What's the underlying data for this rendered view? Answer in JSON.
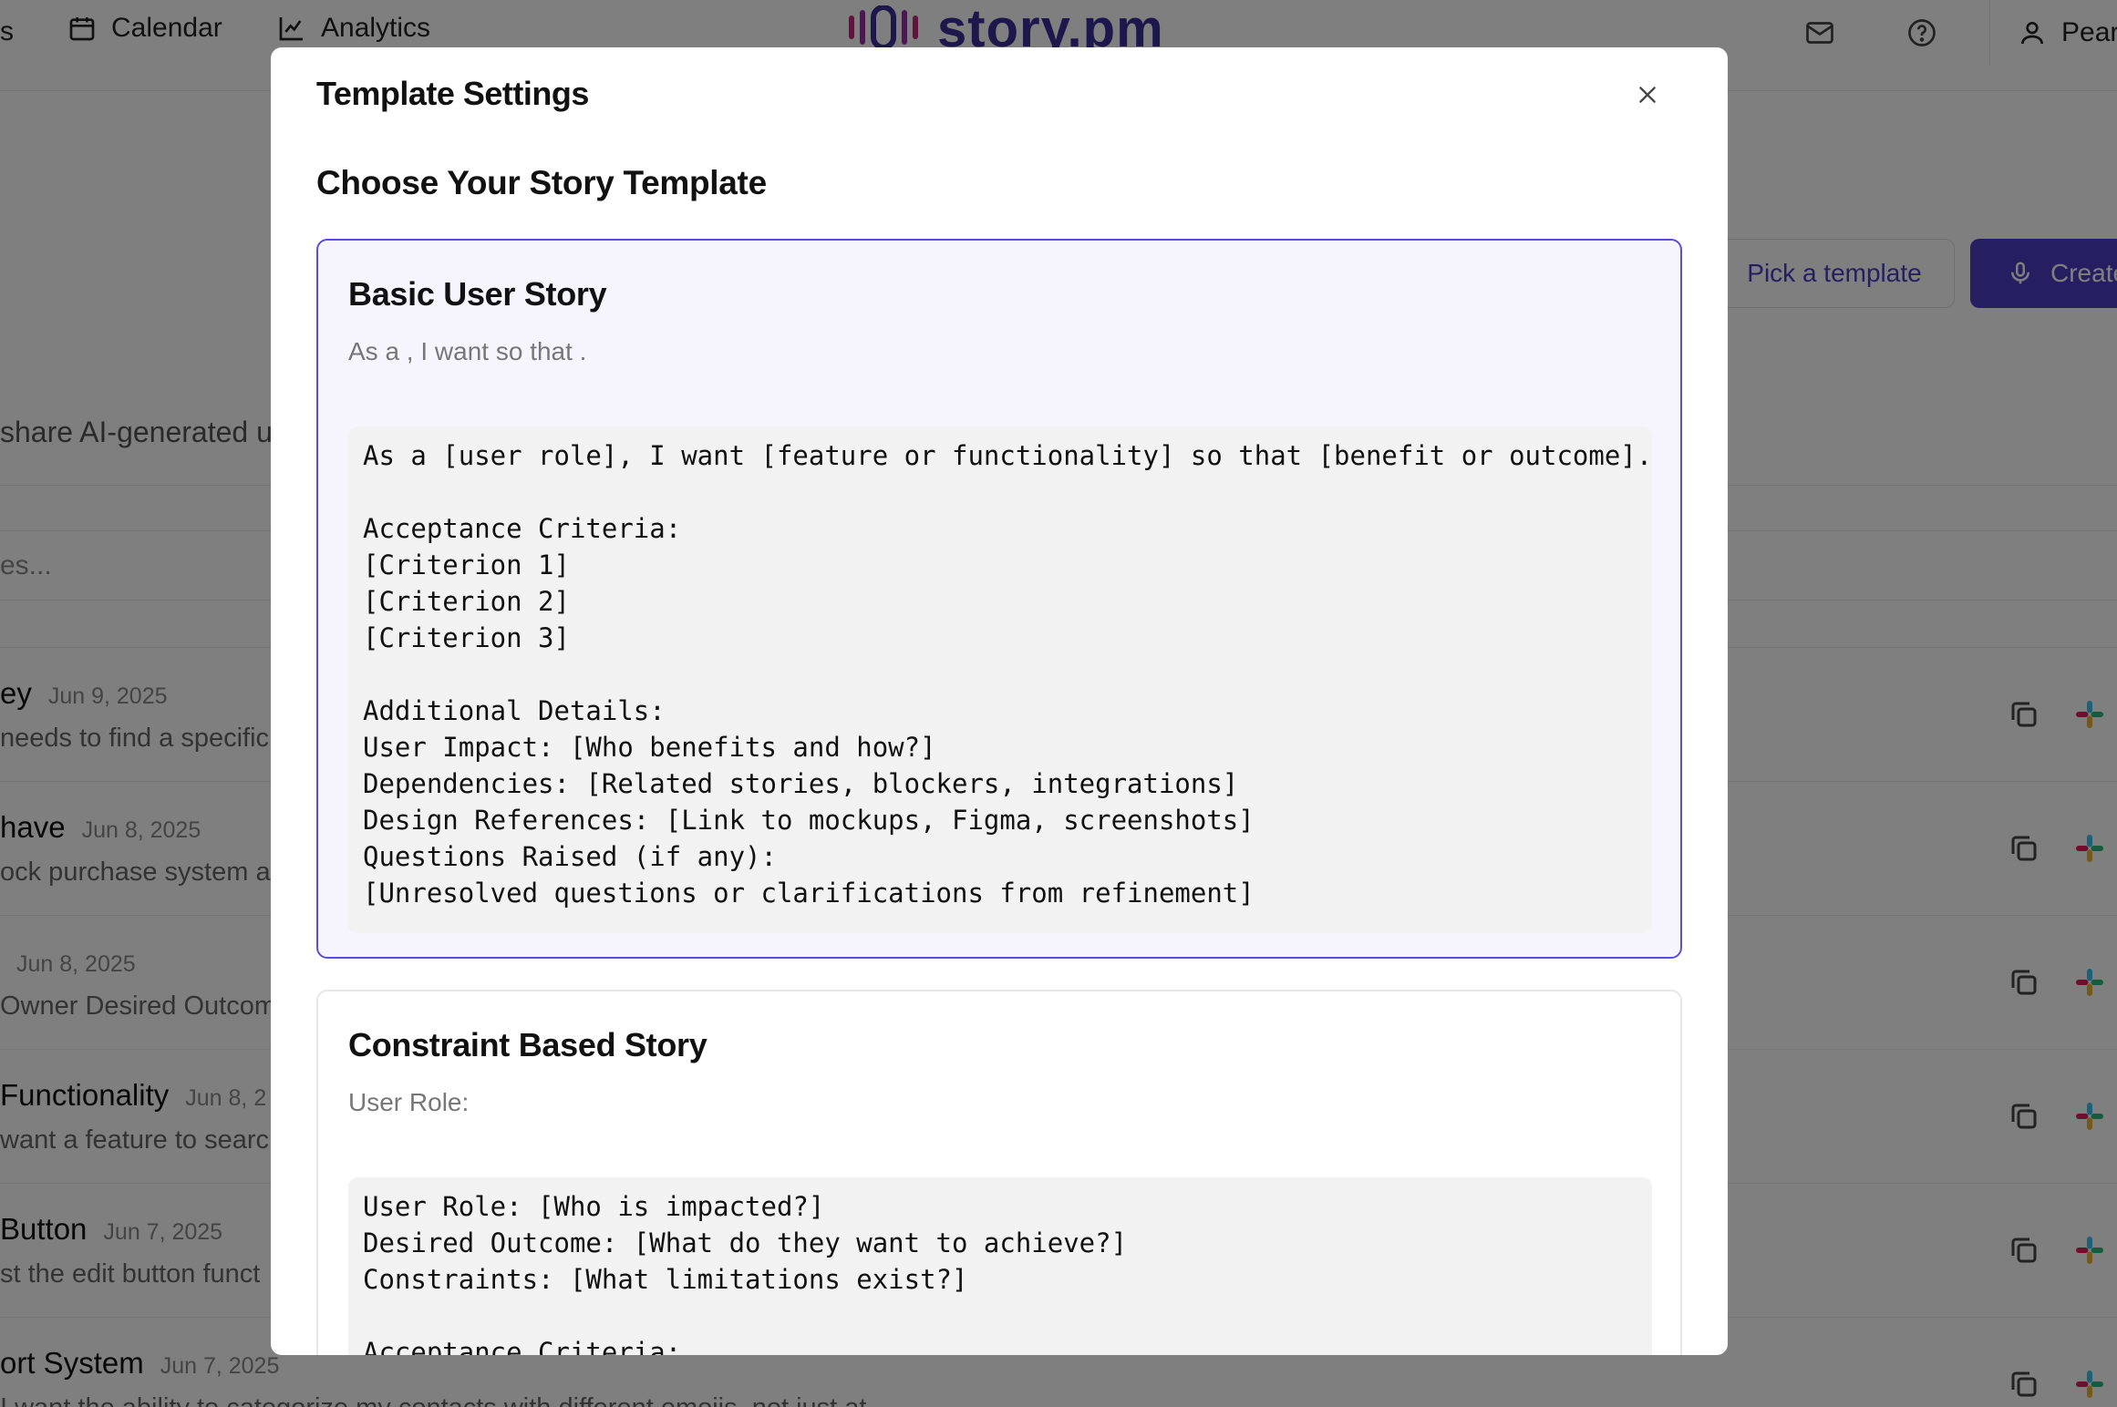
{
  "nav": {
    "left_fragment": "s",
    "calendar_label": "Calendar",
    "analytics_label": "Analytics",
    "logo_text": "story.pm",
    "user_label": "Pear"
  },
  "toolbar": {
    "pick_template_label": "Pick a template",
    "create_label": "Create"
  },
  "page": {
    "subtitle_fragment": "share AI-generated u",
    "search_fragment": "es..."
  },
  "stories": [
    {
      "title": "ey",
      "date": "Jun 9, 2025",
      "desc": "needs to find a specific"
    },
    {
      "title": "have",
      "date": "Jun 8, 2025",
      "desc": "ock purchase system a"
    },
    {
      "title": "",
      "date": "Jun 8, 2025",
      "desc": "Owner Desired Outcom"
    },
    {
      "title": "Functionality",
      "date": "Jun 8, 2",
      "desc": "want a feature to searc"
    },
    {
      "title": "Button",
      "date": "Jun 7, 2025",
      "desc": "st the edit button funct"
    },
    {
      "title": "ort System",
      "date": "Jun 7, 2025",
      "desc": "I want the ability to categorize my contacts with different emojis, not just at"
    }
  ],
  "modal": {
    "title": "Template Settings",
    "section_heading": "Choose Your Story Template",
    "templates": [
      {
        "name": "Basic User Story",
        "description": "As a , I want so that .",
        "body": "As a [user role], I want [feature or functionality] so that [benefit or outcome].\n\nAcceptance Criteria:\n[Criterion 1]\n[Criterion 2]\n[Criterion 3]\n\nAdditional Details:\nUser Impact: [Who benefits and how?]\nDependencies: [Related stories, blockers, integrations]\nDesign References: [Link to mockups, Figma, screenshots]\nQuestions Raised (if any):\n[Unresolved questions or clarifications from refinement]",
        "selected": true
      },
      {
        "name": "Constraint Based Story",
        "description": "User Role:",
        "body": "User Role: [Who is impacted?]\nDesired Outcome: [What do they want to achieve?]\nConstraints: [What limitations exist?]\n\nAcceptance Criteria:",
        "selected": false
      }
    ]
  },
  "colors": {
    "accent": "#4b3fc2",
    "selected_border": "#5b4fd6",
    "selected_bg": "#f6f5fe",
    "overlay": "rgba(0,0,0,0.5)"
  },
  "icons": [
    "calendar-icon",
    "analytics-icon",
    "mail-icon",
    "help-icon",
    "user-icon",
    "microphone-icon",
    "close-icon",
    "copy-icon",
    "slack-icon"
  ]
}
